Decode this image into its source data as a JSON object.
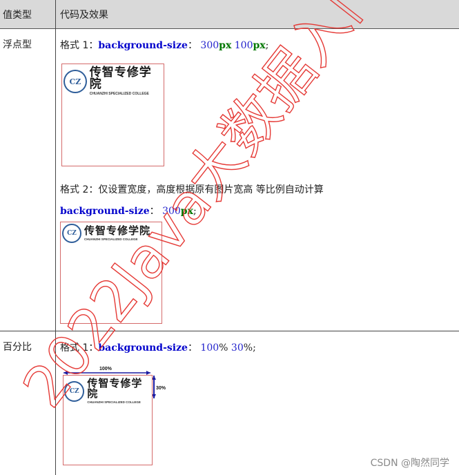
{
  "table": {
    "header": {
      "col1": "值类型",
      "col2": "代码及效果"
    },
    "rows": [
      {
        "label": "浮点型",
        "format1": {
          "prefix": "格式 1：",
          "property": "background-size",
          "colon": "：",
          "v1": "300",
          "u1": "px",
          "v2": "100",
          "u2": "px",
          "end": ";"
        },
        "format2": {
          "note": "格式 2：仅设置宽度，高度根据原有图片宽高 等比例自动计算",
          "property": "background-size",
          "colon": "：",
          "v1": "300",
          "u1": "px",
          "end": ";"
        }
      },
      {
        "label": "百分比",
        "format1": {
          "prefix": "格式 1：",
          "property": "background-size",
          "colon": "：",
          "v1": "100",
          "u1": "%",
          "v2": "30",
          "u2": "%",
          "end": ";"
        },
        "dim_width": "100%",
        "dim_height": "30%"
      }
    ]
  },
  "logo": {
    "cn": "传智专修学院",
    "en": "CHUANZHI SPECIALIZED COLLEGE",
    "emblem": "CZ"
  },
  "watermark_text": "2022Java大数据入门",
  "credit": "CSDN @陶然同学",
  "colors": {
    "header_bg": "#d9d9d9",
    "prop": "#0000cc",
    "unit": "#007700",
    "box_border": "#d46a6a",
    "watermark": "#ff0000"
  }
}
